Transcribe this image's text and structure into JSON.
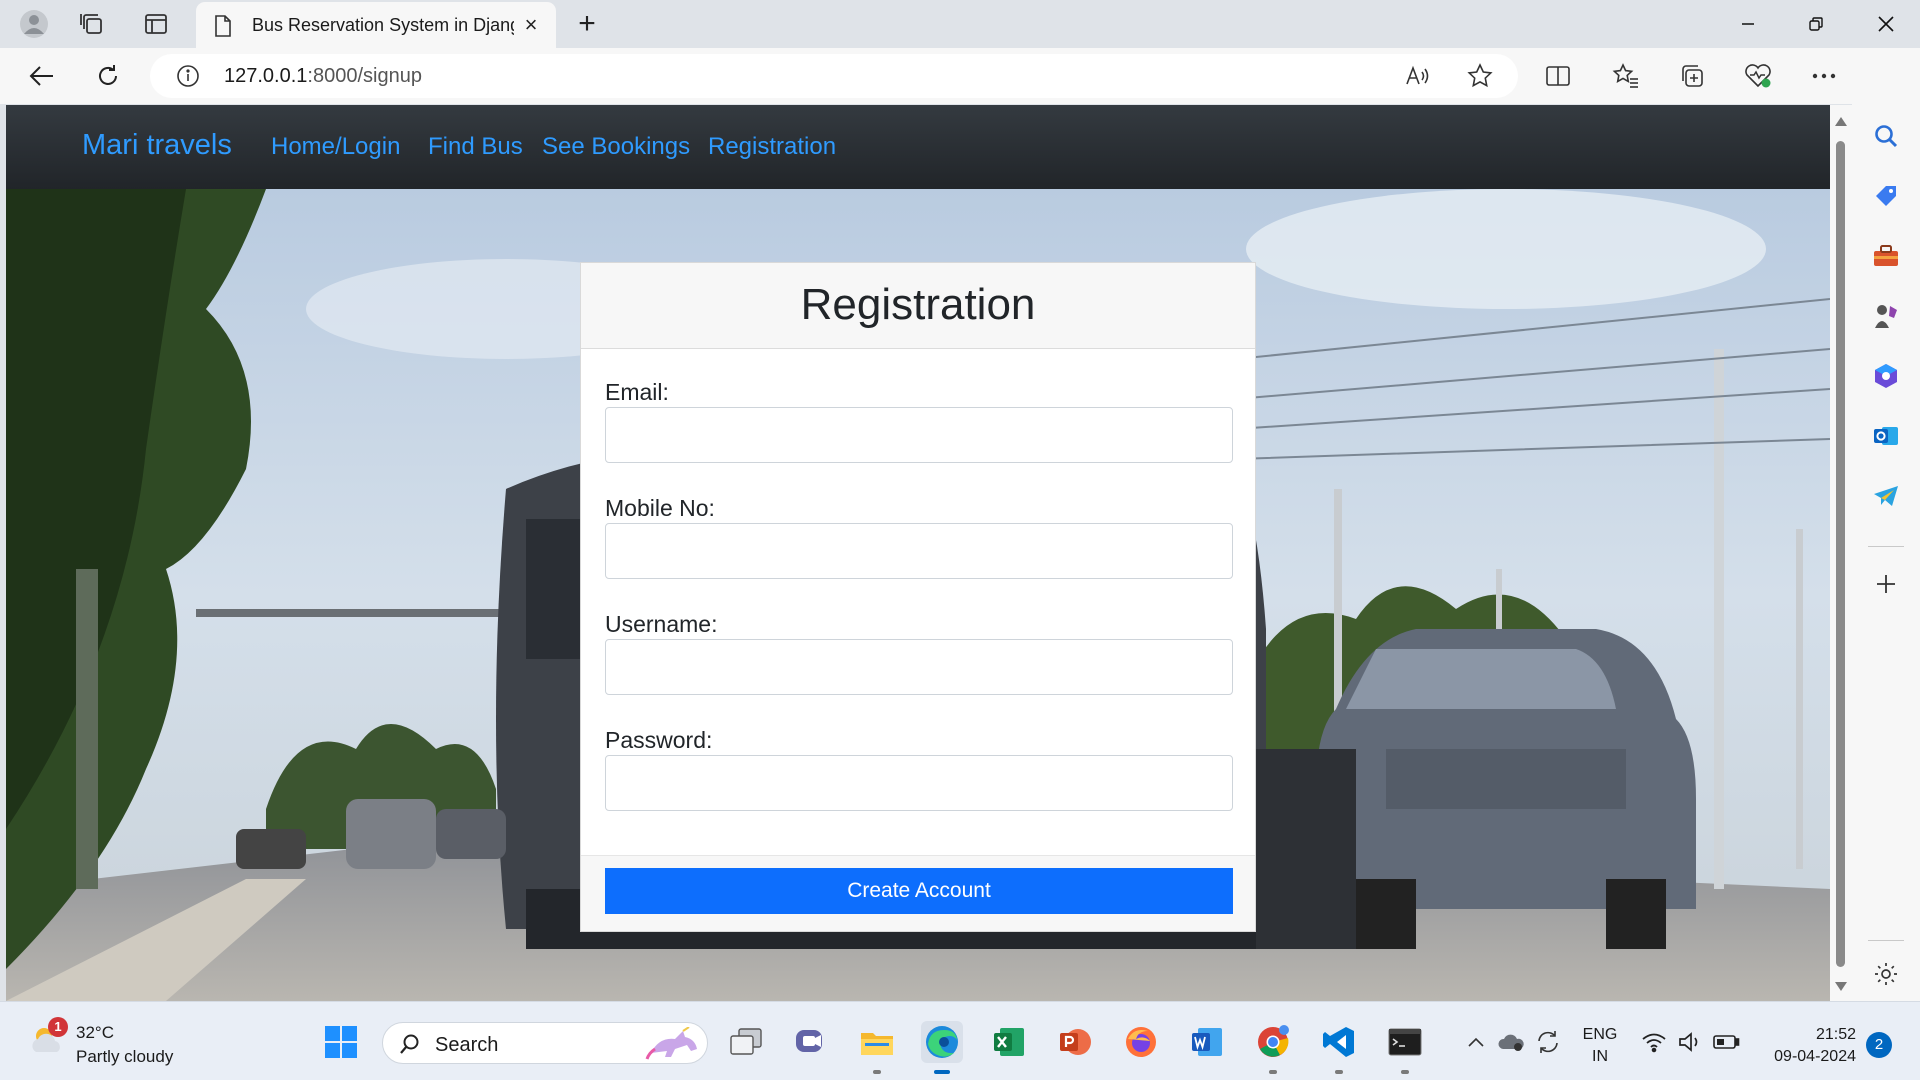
{
  "browser": {
    "tab_title": "Bus Reservation System in Django",
    "url_host": "127.0.0.1",
    "url_path": ":8000/signup"
  },
  "site": {
    "brand": "Mari travels",
    "nav": [
      {
        "label": "Home/Login"
      },
      {
        "label": "Find Bus"
      },
      {
        "label": "See Bookings"
      },
      {
        "label": "Registration"
      }
    ]
  },
  "form": {
    "title": "Registration",
    "fields": [
      {
        "label": "Email:",
        "value": ""
      },
      {
        "label": "Mobile No:",
        "value": ""
      },
      {
        "label": "Username:",
        "value": ""
      },
      {
        "label": "Password:",
        "value": ""
      }
    ],
    "submit_label": "Create Account"
  },
  "taskbar": {
    "weather_badge": "1",
    "weather_temp": "32°C",
    "weather_desc": "Partly cloudy",
    "search_placeholder": "Search",
    "lang_line1": "ENG",
    "lang_line2": "IN",
    "time": "21:52",
    "date": "09-04-2024",
    "notification_count": "2"
  },
  "colors": {
    "navbar": "#212529",
    "link": "#2f9bff",
    "primary_button": "#0d6efd",
    "card_header": "#f7f7f7"
  },
  "icons": {
    "titlebar": [
      "profile-icon",
      "workspaces-icon",
      "vertical-tabs-icon",
      "document-icon",
      "close-tab-icon",
      "new-tab-icon",
      "minimize-icon",
      "restore-icon",
      "close-window-icon"
    ],
    "toolbar": [
      "back-icon",
      "refresh-icon",
      "info-icon",
      "read-aloud-icon",
      "favorite-star-icon",
      "split-screen-icon",
      "favorites-icon",
      "collections-icon",
      "browser-essentials-icon",
      "more-icon",
      "copilot-icon"
    ],
    "sidebar": [
      "search-icon",
      "shopping-tag-icon",
      "toolbox-icon",
      "games-icon",
      "microsoft-365-icon",
      "outlook-icon",
      "telegram-icon",
      "add-icon",
      "settings-icon"
    ]
  }
}
